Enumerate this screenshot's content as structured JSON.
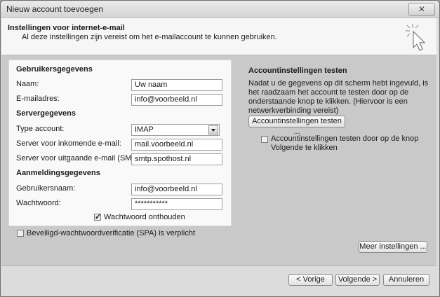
{
  "window": {
    "title": "Nieuw account toevoegen",
    "close_label": "✕"
  },
  "header": {
    "title": "Instellingen voor internet-e-mail",
    "subtitle": "Al deze instellingen zijn vereist om het e-mailaccount te kunnen gebruiken.",
    "icon": "cursor-click-icon"
  },
  "user_info": {
    "heading": "Gebruikersgegevens",
    "name_label": "Naam:",
    "name_value": "Uw naam",
    "email_label": "E-mailadres:",
    "email_value": "info@voorbeeld.nl"
  },
  "server_info": {
    "heading": "Servergegevens",
    "account_type_label": "Type account:",
    "account_type_value": "IMAP",
    "incoming_label": "Server voor inkomende e-mail:",
    "incoming_value": "mail.voorbeeld.nl",
    "outgoing_label": "Server voor uitgaande e-mail (SMTP):",
    "outgoing_value": "smtp.spothost.nl"
  },
  "logon_info": {
    "heading": "Aanmeldingsgegevens",
    "username_label": "Gebruikersnaam:",
    "username_value": "info@voorbeeld.nl",
    "password_label": "Wachtwoord:",
    "password_value": "***********",
    "remember_label": "Wachtwoord onthouden",
    "remember_checked": true
  },
  "spa": {
    "label": "Beveiligd-wachtwoordverificatie (SPA) is verplicht",
    "checked": false
  },
  "test": {
    "heading": "Accountinstellingen testen",
    "description": "Nadat u de gegevens op dit scherm hebt ingevuld, is het raadzaam het account te testen door op de onderstaande knop te klikken. (Hiervoor is een netwerkverbinding vereist)",
    "button_label": "Accountinstellingen testen ...",
    "auto_label_line1": "Accountinstellingen testen door op de knop",
    "auto_label_line2": "Volgende te klikken",
    "auto_checked": false
  },
  "more_settings_label": "Meer instellingen ...",
  "footer": {
    "back_label": "< Vorige",
    "next_label": "Volgende >",
    "cancel_label": "Annuleren"
  }
}
